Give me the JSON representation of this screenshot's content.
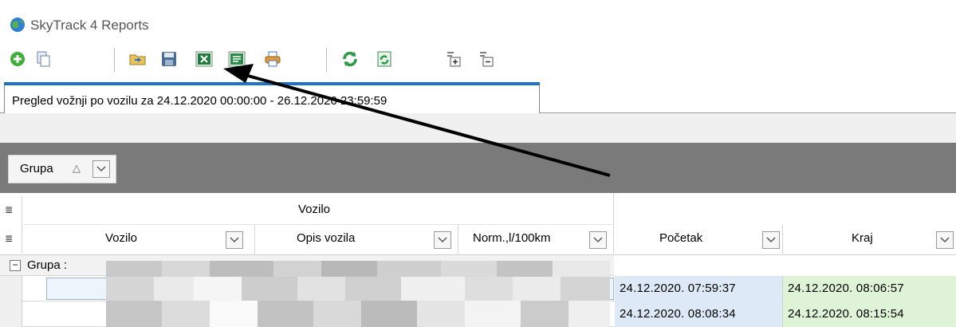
{
  "window": {
    "title": "SkyTrack 4 Reports"
  },
  "toolbar": {
    "buttons": [
      "add-icon",
      "copy-icon",
      "open-folder-icon",
      "save-icon",
      "export-excel-icon",
      "export-excel-alt-icon",
      "print-icon",
      "refresh-icon",
      "refresh-page-icon",
      "expand-group-icon",
      "collapse-group-icon"
    ]
  },
  "tab": {
    "label": "Pregled vožnji po vozilu za 24.12.2020 00:00:00 - 26.12.2020 23:59:59"
  },
  "groupby": {
    "label": "Grupa",
    "sort_glyph": "△"
  },
  "grid": {
    "band_label": "Vozilo",
    "columns": [
      "Vozilo",
      "Opis vozila",
      "Norm.,l/100km",
      "Početak",
      "Kraj"
    ],
    "group_row_label": "Grupa :",
    "rows": [
      {
        "start": "24.12.2020. 07:59:37",
        "end": "24.12.2020. 08:06:57"
      },
      {
        "start": "24.12.2020. 08:08:34",
        "end": "24.12.2020. 08:15:54"
      }
    ]
  },
  "colors": {
    "tab_accent": "#1f73c3",
    "group_area": "#7a7a7a",
    "start_cell": "#dde9f7",
    "end_cell": "#dff4d7"
  }
}
